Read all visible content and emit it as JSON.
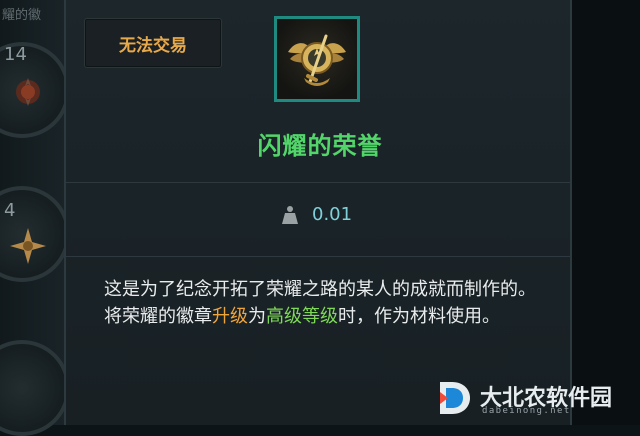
{
  "inventory": {
    "title_fragment": "耀的徽",
    "slots": [
      {
        "count": "14",
        "emblem": "dark-emblem-icon"
      },
      {
        "count": "4",
        "emblem": "gold-cross-emblem-icon"
      },
      {
        "count": "",
        "emblem": "emblem-icon"
      }
    ]
  },
  "tooltip": {
    "trade_status": "无法交易",
    "item_name": "闪耀的荣誉",
    "item_icon": "winged-gold-medal-icon",
    "weight_icon": "weight-icon",
    "weight": "0.01",
    "description": {
      "line1": "这是为了纪念开拓了荣耀之路的某人的成就而制作的。",
      "line2_prefix": "将荣耀的徽章",
      "line2_upgrade": "升级",
      "line2_mid": "为",
      "line2_level": "高级等级",
      "line2_suffix": "时，作为材料使用。"
    }
  },
  "colors": {
    "item_name": "#52d66a",
    "trade_badge": "#e8a94a",
    "highlight_upgrade": "#f0a53a",
    "highlight_level": "#7ed957",
    "icon_border": "#1f8a80",
    "weight_value": "#7fd0d8"
  },
  "watermark": {
    "logo": "d-logo-icon",
    "name": "大北农软件园",
    "url": "dabeinong.net"
  }
}
